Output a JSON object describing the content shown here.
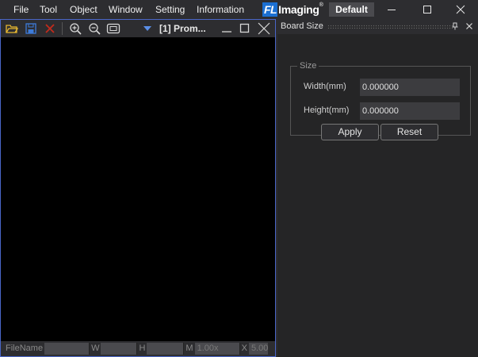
{
  "menu": [
    {
      "label": "File"
    },
    {
      "label": "Tool"
    },
    {
      "label": "Object"
    },
    {
      "label": "Window"
    },
    {
      "label": "Setting"
    },
    {
      "label": "Information"
    }
  ],
  "brand": {
    "fl": "FL",
    "imaging": "Imaging",
    "reg": "®"
  },
  "profile": "Default",
  "window_controls": {
    "minimize": "minimize-icon",
    "maximize": "maximize-icon",
    "close": "close-icon"
  },
  "viewer": {
    "title": "[1] Prom...",
    "toolbar_icons": [
      "open-folder-icon",
      "save-icon",
      "close-x-icon",
      "zoom-in-icon",
      "zoom-out-icon",
      "fit-icon",
      "dropdown-arrow-icon"
    ],
    "status": {
      "filename_label": "FileName",
      "filename_value": "",
      "w_label": "W",
      "w_value": "",
      "h_label": "H",
      "h_value": "",
      "m_label": "M",
      "m_value": "1.00x",
      "x_label": "X",
      "x_value": "5.00"
    }
  },
  "dock": {
    "title": "Board Size",
    "group_title": "Size",
    "width_label": "Width(mm)",
    "width_value": "0.000000",
    "height_label": "Height(mm)",
    "height_value": "0.000000",
    "apply_label": "Apply",
    "reset_label": "Reset"
  },
  "colors": {
    "accent": "#4a66c8",
    "brand_blue": "#1b6fd1",
    "close_red": "#c42b1c",
    "open_yellow": "#e8b830",
    "save_blue": "#3d7bd9",
    "dropdown_blue": "#5b8fe8"
  }
}
